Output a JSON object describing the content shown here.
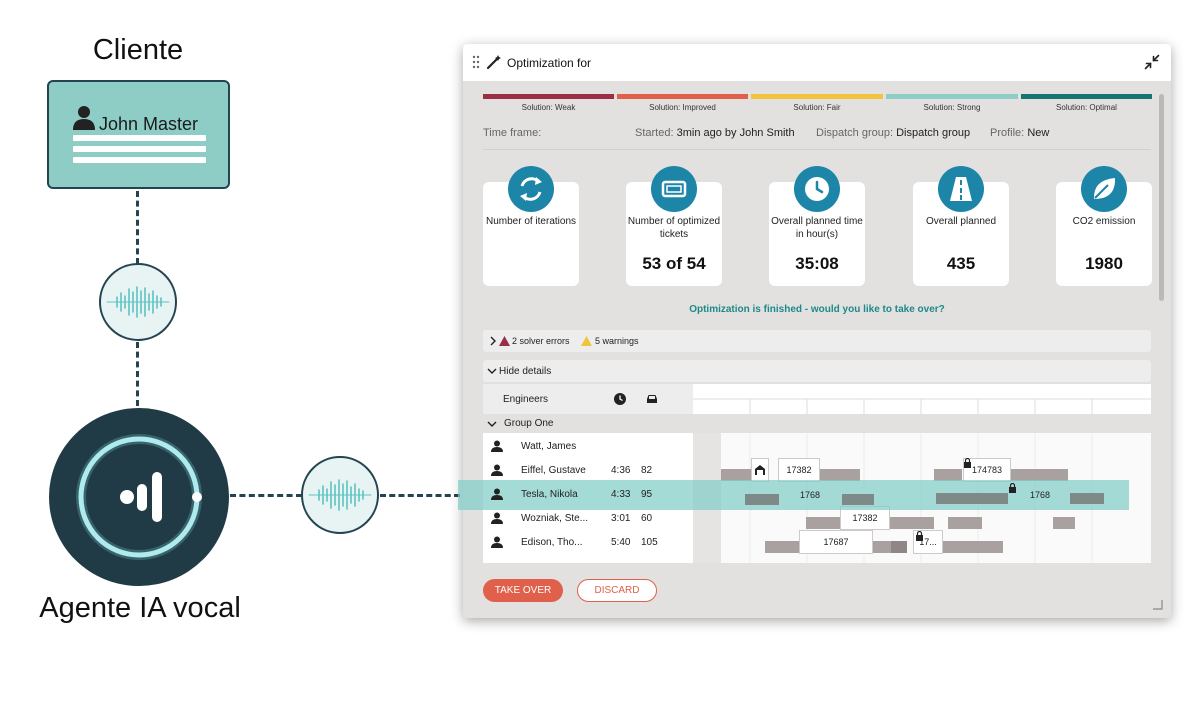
{
  "diagram": {
    "client_title": "Cliente",
    "client_name": "John Master",
    "agent_label": "Agente IA vocal"
  },
  "window": {
    "title": "Optimization for",
    "solution_levels": [
      {
        "label": "Solution: Weak",
        "color": "#9b2d45"
      },
      {
        "label": "Solution: Improved",
        "color": "#e0604c"
      },
      {
        "label": "Solution: Fair",
        "color": "#f2c43d"
      },
      {
        "label": "Solution: Strong",
        "color": "#8ecdc6"
      },
      {
        "label": "Solution: Optimal",
        "color": "#167570"
      }
    ],
    "meta": {
      "time_frame_label": "Time frame:",
      "started_label": "Started:",
      "started_value": "3min ago by John Smith",
      "dispatch_label": "Dispatch group:",
      "dispatch_value": "Dispatch group",
      "profile_label": "Profile:",
      "profile_value": "New"
    },
    "kpis": [
      {
        "icon": "refresh-icon",
        "label": "Number of iterations",
        "value": ""
      },
      {
        "icon": "ticket-icon",
        "label": "Number of optimized tickets",
        "value": "53 of 54"
      },
      {
        "icon": "clock-icon",
        "label": "Overall planned time in hour(s)",
        "value": "35:08"
      },
      {
        "icon": "road-icon",
        "label": "Overall planned",
        "value": "435"
      },
      {
        "icon": "leaf-icon",
        "label": "CO2 emission",
        "value": "1980"
      }
    ],
    "finished_message": "Optimization is finished - would you like to take over?",
    "errors": {
      "solver_errors": "2 solver errors",
      "warnings": "5 warnings"
    },
    "details_toggle": "Hide details",
    "engineers_header": "Engineers",
    "group_name": "Group One",
    "engineers": [
      {
        "name": "Watt, James",
        "time": "",
        "count": ""
      },
      {
        "name": "Eiffel, Gustave",
        "time": "4:36",
        "count": "82"
      },
      {
        "name": "Tesla, Nikola",
        "time": "4:33",
        "count": "95"
      },
      {
        "name": "Wozniak, Ste...",
        "time": "3:01",
        "count": "60"
      },
      {
        "name": "Edison, Tho...",
        "time": "5:40",
        "count": "105"
      }
    ],
    "gantt_tickets": {
      "eiffel_1": "17382",
      "eiffel_2": "174783",
      "tesla_1": "1768",
      "tesla_2": "1768",
      "wozniak_1": "17382",
      "edison_1": "17687",
      "edison_2": "17..."
    },
    "take_over_label": "TAKE OVER",
    "discard_label": "DISCARD"
  },
  "colors": {
    "accent_teal": "#1d86a8",
    "take_over": "#e0604c",
    "highlight": "#82cdc8"
  }
}
